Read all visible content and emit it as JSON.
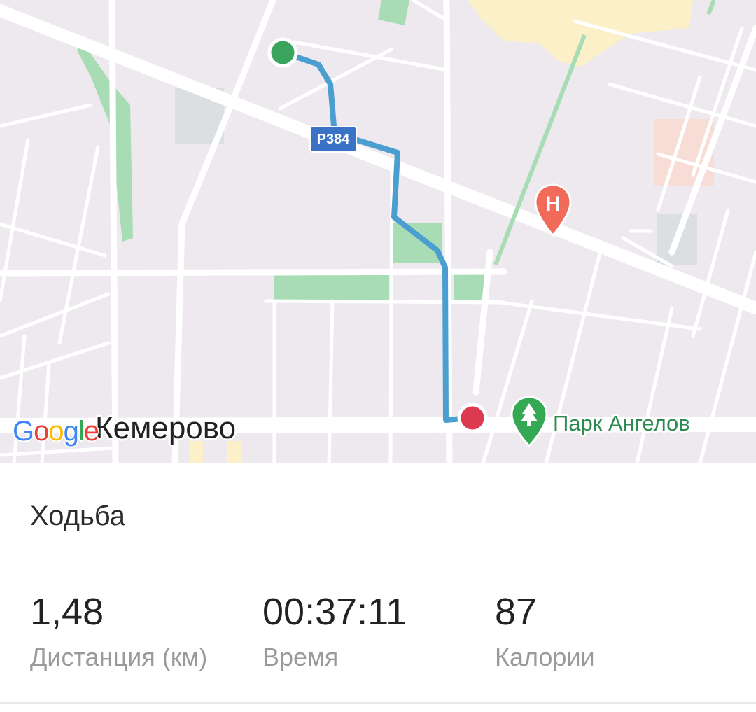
{
  "map": {
    "city_label": "Кемерово",
    "poi_label": "Парк Ангелов",
    "road_shield": "Р384",
    "hospital_glyph": "H",
    "logo": {
      "letters": [
        "G",
        "o",
        "o",
        "g",
        "l",
        "e"
      ]
    },
    "route": {
      "color": "#4a9fd0",
      "start": {
        "color": "#3aa45d"
      },
      "end": {
        "color": "#dc3a4e"
      }
    },
    "colors": {
      "background": "#ede9ee",
      "park": "#a8dcb5",
      "road": "#ffffff",
      "hospital_pin": "#f26b5a",
      "park_pin": "#34a853"
    }
  },
  "activity": {
    "title": "Ходьба",
    "stats": [
      {
        "value": "1,48",
        "label": "Дистанция (км)"
      },
      {
        "value": "00:37:11",
        "label": "Время"
      },
      {
        "value": "87",
        "label": "Калории"
      }
    ]
  }
}
